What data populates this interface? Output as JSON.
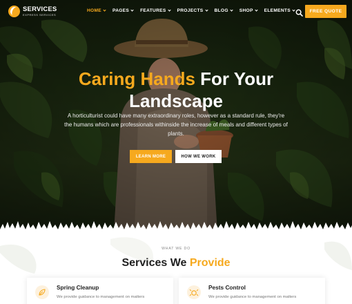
{
  "brand": {
    "name": "SERVICES",
    "tagline": "EXPRESS SERVICES",
    "accent_color": "#f6a91e"
  },
  "nav": {
    "items": [
      {
        "label": "HOME",
        "active": true,
        "has_dropdown": true
      },
      {
        "label": "PAGES",
        "active": false,
        "has_dropdown": true
      },
      {
        "label": "FEATURES",
        "active": false,
        "has_dropdown": true
      },
      {
        "label": "PROJECTS",
        "active": false,
        "has_dropdown": true
      },
      {
        "label": "BLOG",
        "active": false,
        "has_dropdown": true
      },
      {
        "label": "SHOP",
        "active": false,
        "has_dropdown": true
      },
      {
        "label": "ELEMENTS",
        "active": false,
        "has_dropdown": true
      }
    ],
    "search_icon": "search-icon",
    "cta_label": "FREE QUOTE"
  },
  "hero": {
    "title_accent": "Caring Hands",
    "title_rest": " For Your",
    "title_line2": "Landscape",
    "description": "A horticulturist could have many extraordinary roles, however as a standard rule, they're the humans which are professionals withinside the increase of meals and different types of plants.",
    "primary_button": "LEARN MORE",
    "secondary_button": "HOW WE WORK"
  },
  "services": {
    "eyebrow": "WHAT WE DO",
    "title_main": "Services We ",
    "title_accent": "Provide",
    "cards": [
      {
        "icon": "leaf-rake-icon",
        "title": "Spring Cleanup",
        "text": "We provide guidance to management on matters"
      },
      {
        "icon": "pest-icon",
        "title": "Pests Control",
        "text": "We provide guidance to management on matters"
      }
    ]
  }
}
